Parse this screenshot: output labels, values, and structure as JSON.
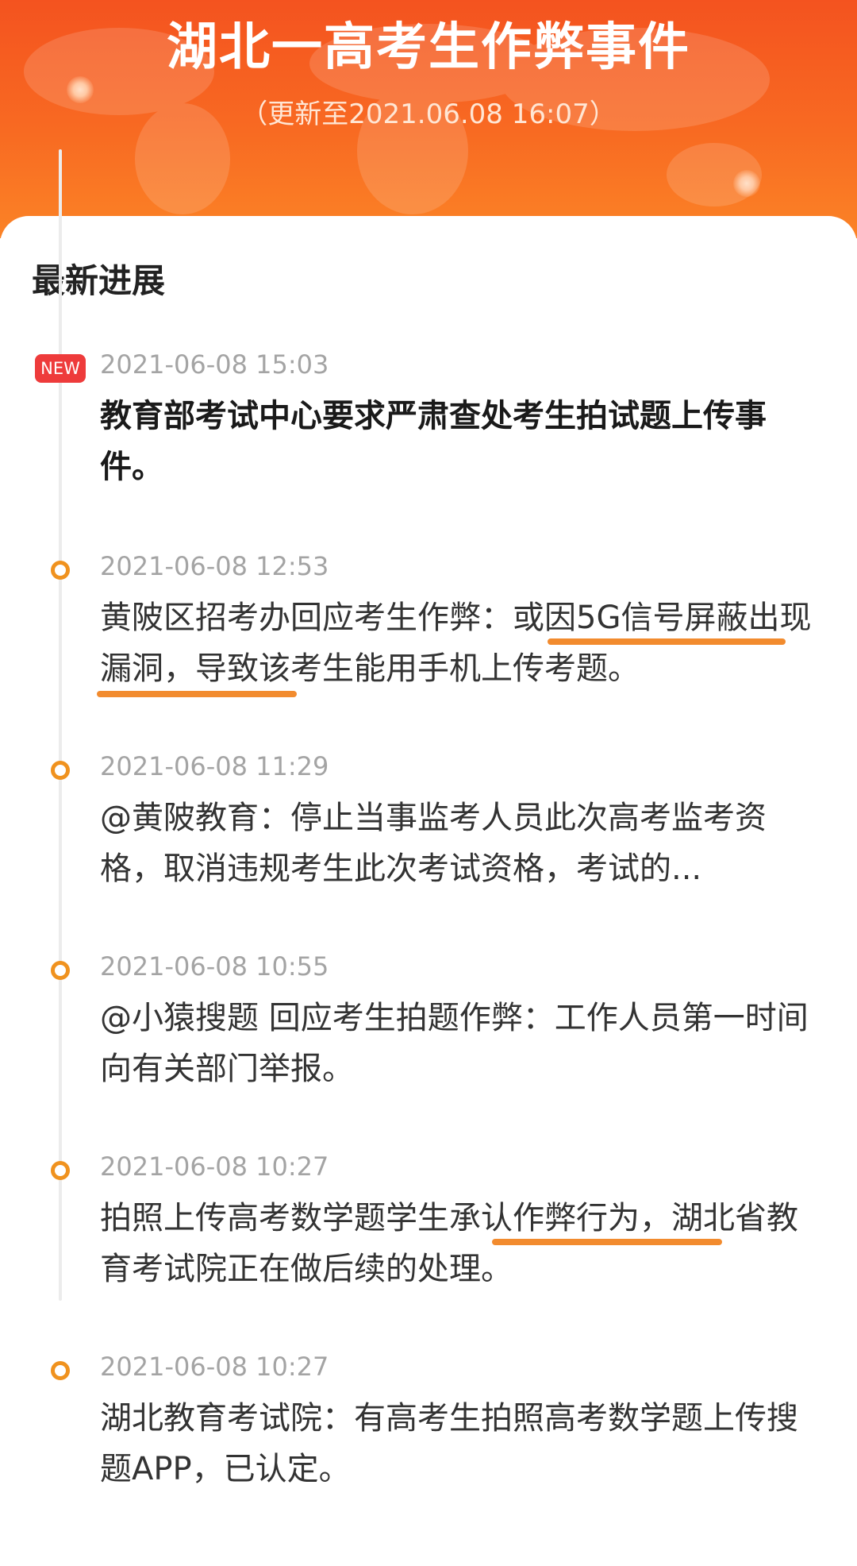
{
  "header": {
    "title": "湖北一高考生作弊事件",
    "updated": "（更新至2021.06.08 16:07）"
  },
  "section": {
    "title": "最新进展"
  },
  "badge": {
    "new": "NEW"
  },
  "timeline": [
    {
      "time": "2021-06-08 15:03",
      "text": "教育部考试中心要求严肃查处考生拍试题上传事件。"
    },
    {
      "time": "2021-06-08 12:53",
      "text": "黄陂区招考办回应考生作弊：或因5G信号屏蔽出现漏洞，导致该考生能用手机上传考题。"
    },
    {
      "time": "2021-06-08 11:29",
      "text": "@黄陂教育：停止当事监考人员此次高考监考资格，取消违规考生此次考试资格，考试的..."
    },
    {
      "time": "2021-06-08 10:55",
      "text": "@小猿搜题 回应考生拍题作弊：工作人员第一时间向有关部门举报。"
    },
    {
      "time": "2021-06-08 10:27",
      "text": "拍照上传高考数学题学生承认作弊行为，湖北省教育考试院正在做后续的处理。"
    },
    {
      "time": "2021-06-08 10:27",
      "text": "湖北教育考试院：有高考生拍照高考数学题上传搜题APP，已认定。"
    }
  ],
  "colors": {
    "header_orange": "#f86a22",
    "new_badge": "#ee3b3b",
    "marker": "#f0921e",
    "annotation_underline": "#f28b2e"
  }
}
